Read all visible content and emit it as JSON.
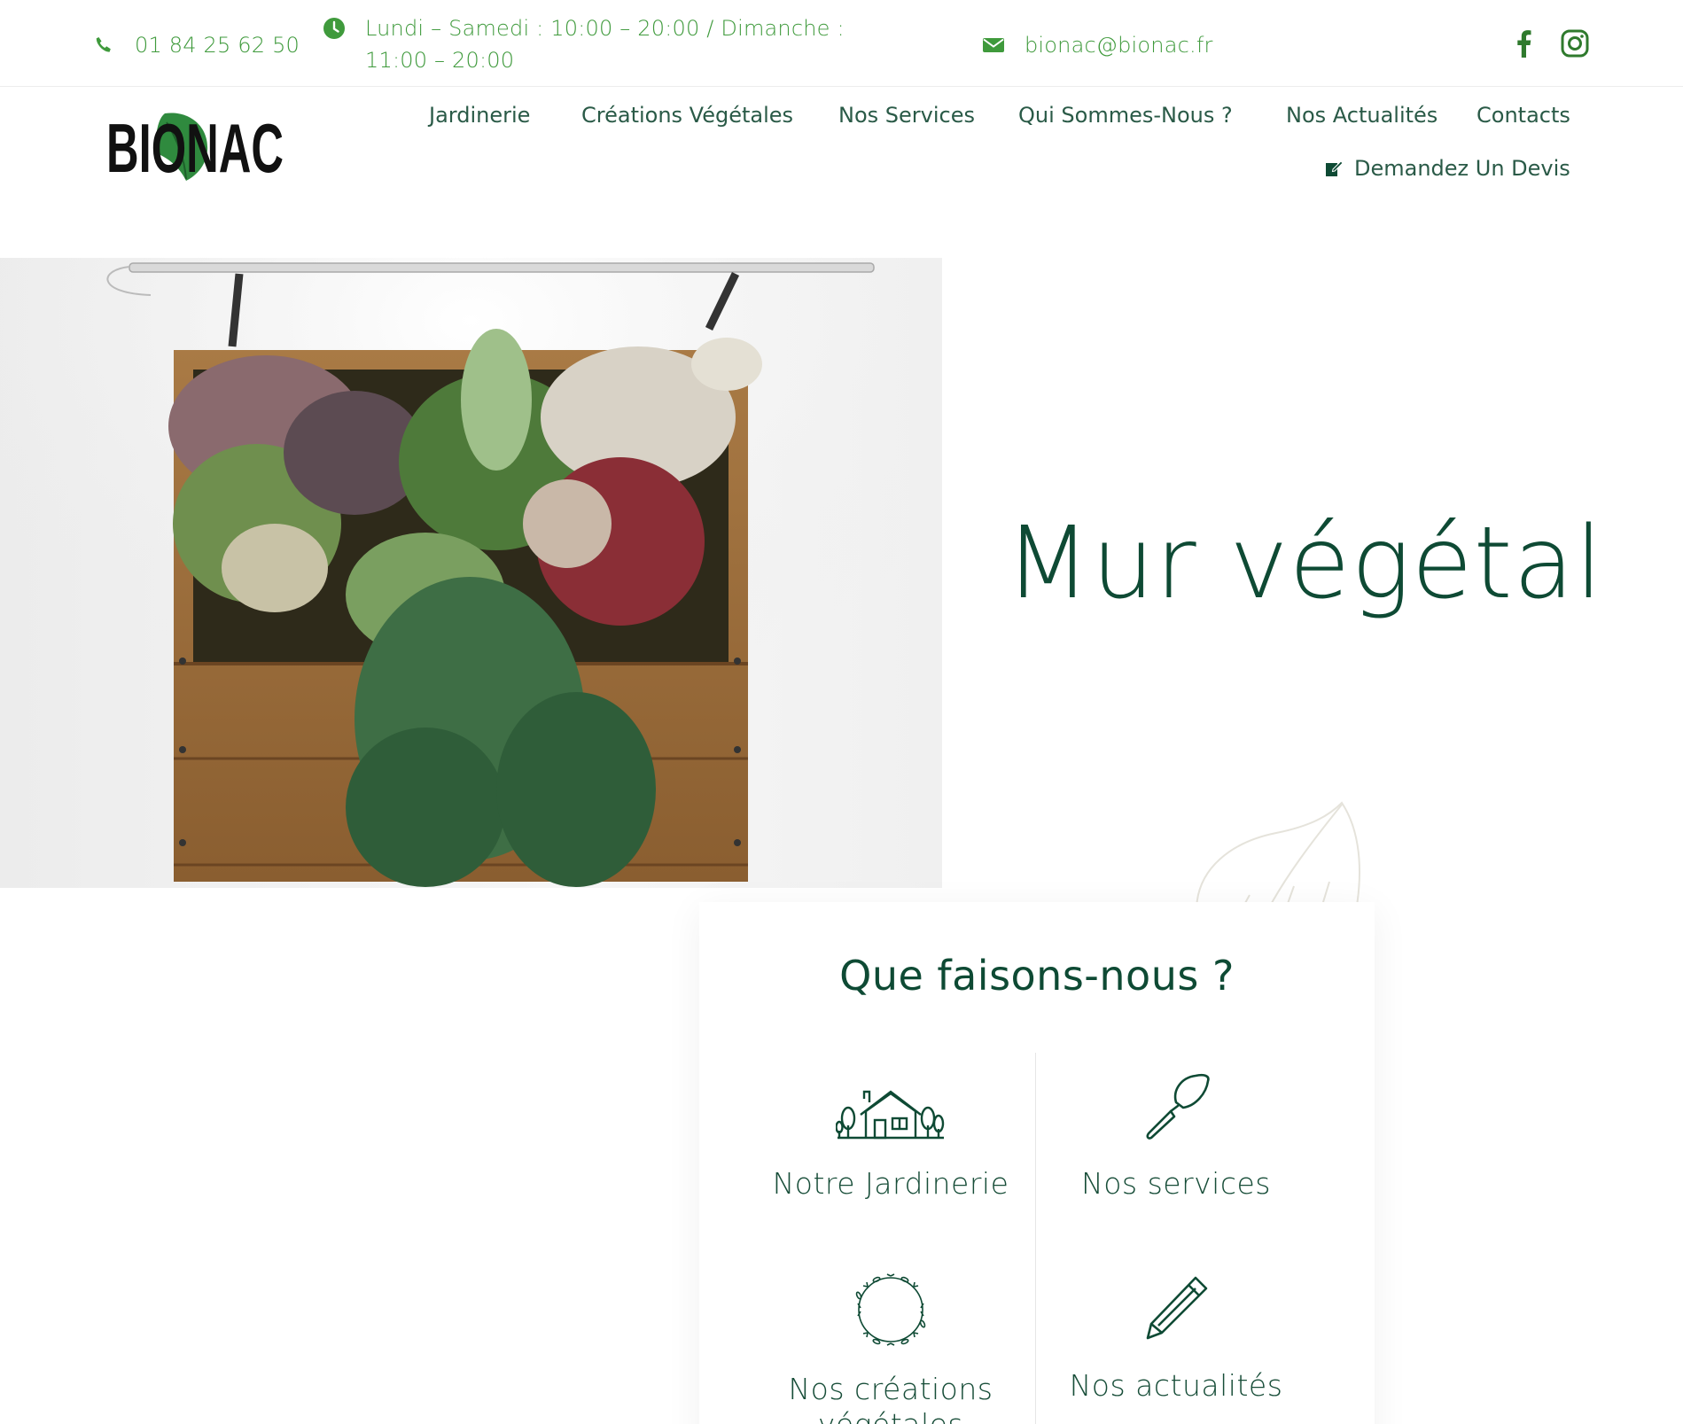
{
  "topbar": {
    "phone": "01 84 25 62 50",
    "hours": "Lundi – Samedi : 10:00 – 20:00 / Dimanche : 11:00 – 20:00",
    "email": "bionac@bionac.fr",
    "phone_icon": "phone-icon",
    "clock_icon": "clock-icon",
    "mail_icon": "envelope-icon",
    "social": [
      "facebook-icon",
      "instagram-icon"
    ]
  },
  "brand": {
    "logo_text": "BIONAC"
  },
  "nav": {
    "items": [
      "Jardinerie",
      "Créations Végétales",
      "Nos Services",
      "Qui Sommes-Nous ?",
      "Nos Actualités",
      "Contacts"
    ],
    "cta": "Demandez Un Devis"
  },
  "hero": {
    "title": "Mur végétal",
    "image": "vertical-garden-wooden-planter-photo"
  },
  "services": {
    "title": "Que faisons-nous ?",
    "items": [
      {
        "label": "Notre Jardinerie",
        "icon": "garden-house-icon"
      },
      {
        "label": "Nos services",
        "icon": "trowel-icon"
      },
      {
        "label": "Nos créations végétales",
        "icon": "wreath-icon"
      },
      {
        "label": "Nos actualités",
        "icon": "pencil-icon"
      }
    ]
  },
  "colors": {
    "accent_green": "#3f9a3c",
    "dark_green": "#0e4a34",
    "nav_text": "#2a5a47"
  }
}
